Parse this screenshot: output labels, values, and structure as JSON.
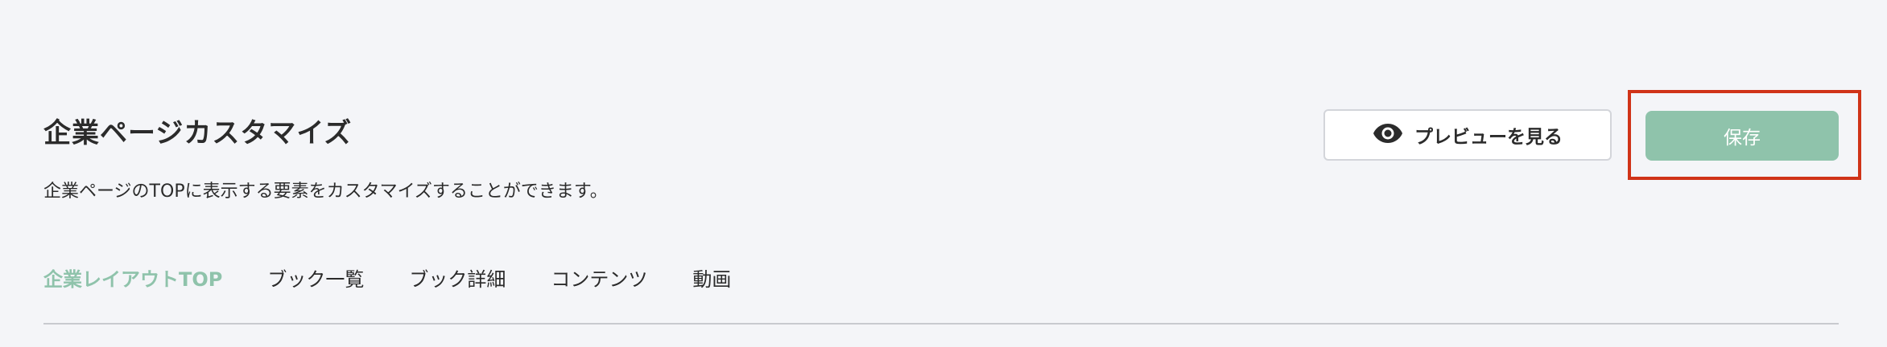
{
  "header": {
    "title": "企業ページカスタマイズ",
    "description": "企業ページのTOPに表示する要素をカスタマイズすることができます。"
  },
  "actions": {
    "preview_label": "プレビューを見る",
    "preview_icon": "eye-icon",
    "save_label": "保存",
    "save_button_color": "#8fc3ab",
    "highlight_color": "#d03318"
  },
  "tabs": [
    {
      "label": "企業レイアウトTOP",
      "active": true
    },
    {
      "label": "ブック一覧",
      "active": false
    },
    {
      "label": "ブック詳細",
      "active": false
    },
    {
      "label": "コンテンツ",
      "active": false
    },
    {
      "label": "動画",
      "active": false
    }
  ],
  "colors": {
    "accent": "#8fc3ab",
    "background": "#f4f5f8",
    "text": "#2b2b2b"
  }
}
